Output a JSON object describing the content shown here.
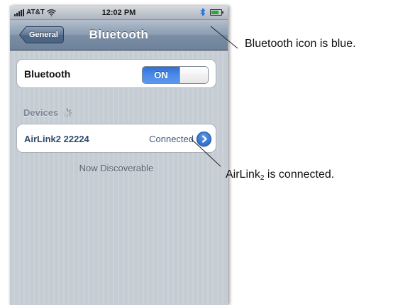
{
  "statusbar": {
    "carrier": "AT&T",
    "time": "12:02 PM",
    "signal_icon": "signal-bars-icon",
    "wifi_icon": "wifi-icon",
    "bluetooth_icon": "bluetooth-icon",
    "battery_icon": "battery-icon",
    "battery_level": 0.8
  },
  "navbar": {
    "back_label": "General",
    "title": "Bluetooth"
  },
  "bluetooth_row": {
    "label": "Bluetooth",
    "toggle_label": "ON",
    "state": "on"
  },
  "devices": {
    "header": "Devices",
    "spinner_icon": "activity-spinner-icon",
    "items": [
      {
        "name": "AirLink2 22224",
        "status": "Connected",
        "icon": "disclosure-arrow-icon"
      }
    ]
  },
  "discoverable_text": "Now Discoverable",
  "annotations": {
    "bluetooth_note": "Bluetooth icon is blue.",
    "airlink_prefix": "AirLink",
    "airlink_subscript": "2",
    "airlink_suffix": " is connected."
  },
  "colors": {
    "toggle_on": "#3b7de0",
    "bluetooth_icon": "#1f6fe0",
    "disclosure": "#2d6fd3",
    "nav_bar": "#7e90a6",
    "background": "#c5ccd4"
  }
}
